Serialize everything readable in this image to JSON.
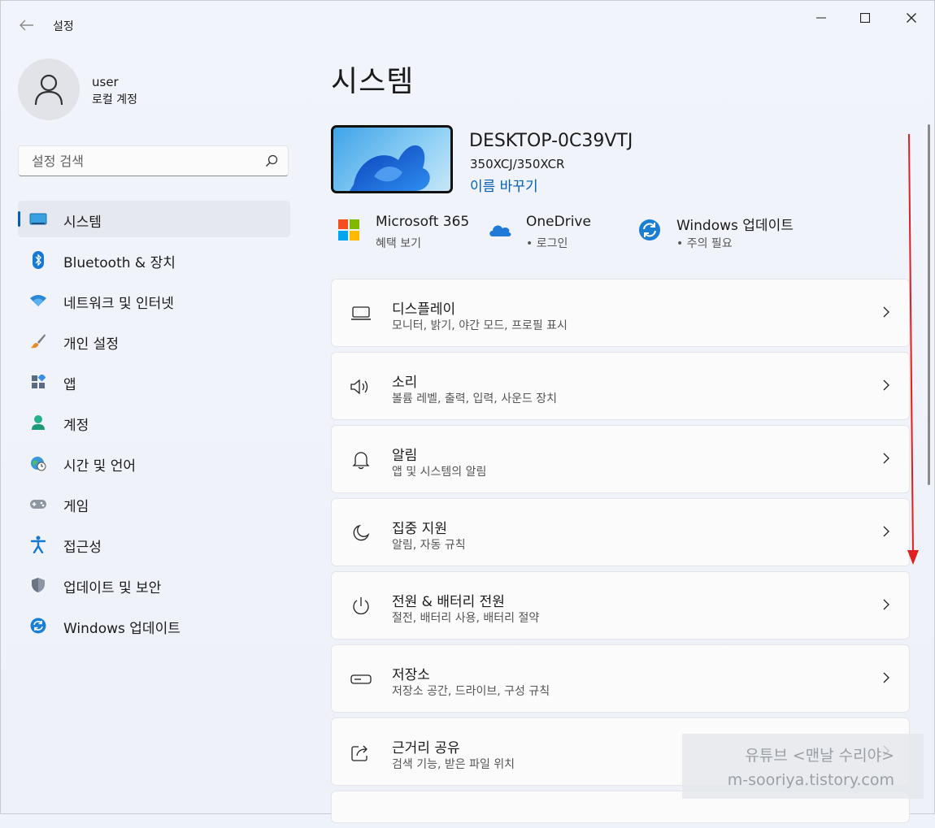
{
  "window": {
    "title": "설정",
    "back_icon": "back-arrow-icon"
  },
  "user": {
    "name": "user",
    "account_type": "로컬 계정"
  },
  "search": {
    "placeholder": "설정 검색"
  },
  "sidebar": {
    "items": [
      {
        "label": "시스템",
        "icon": "system-icon",
        "active": true
      },
      {
        "label": "Bluetooth & 장치",
        "icon": "bluetooth-icon"
      },
      {
        "label": "네트워크 및 인터넷",
        "icon": "wifi-icon"
      },
      {
        "label": "개인 설정",
        "icon": "brush-icon"
      },
      {
        "label": "앱",
        "icon": "apps-icon"
      },
      {
        "label": "계정",
        "icon": "account-icon"
      },
      {
        "label": "시간 및 언어",
        "icon": "globe-clock-icon"
      },
      {
        "label": "게임",
        "icon": "gamepad-icon"
      },
      {
        "label": "접근성",
        "icon": "accessibility-icon"
      },
      {
        "label": "업데이트 및 보안",
        "icon": "shield-icon"
      },
      {
        "label": "Windows 업데이트",
        "icon": "windows-update-icon"
      }
    ]
  },
  "main": {
    "title": "시스템",
    "device": {
      "name": "DESKTOP-0C39VTJ",
      "model": "350XCJ/350XCR",
      "rename": "이름 바꾸기"
    },
    "quick_links": [
      {
        "title": "Microsoft 365",
        "subtitle": "혜택 보기",
        "icon": "microsoft-logo-icon"
      },
      {
        "title": "OneDrive",
        "subtitle": "• 로그인",
        "icon": "onedrive-cloud-icon"
      },
      {
        "title": "Windows 업데이트",
        "subtitle": "• 주의 필요",
        "icon": "windows-update-icon"
      }
    ],
    "cards": [
      {
        "title": "디스플레이",
        "subtitle": "모니터, 밝기, 야간 모드, 프로필 표시",
        "icon": "laptop-icon"
      },
      {
        "title": "소리",
        "subtitle": "볼륨 레벨, 출력, 입력, 사운드 장치",
        "icon": "speaker-icon"
      },
      {
        "title": "알림",
        "subtitle": "앱 및 시스템의 알림",
        "icon": "bell-icon"
      },
      {
        "title": "집중 지원",
        "subtitle": "알림, 자동 규칙",
        "icon": "moon-icon"
      },
      {
        "title": "전원 & 배터리 전원",
        "subtitle": "절전, 배터리 사용, 배터리 절약",
        "icon": "power-icon"
      },
      {
        "title": "저장소",
        "subtitle": "저장소 공간, 드라이브, 구성 규칙",
        "icon": "storage-drive-icon"
      },
      {
        "title": "근거리 공유",
        "subtitle": "검색 기능, 받은 파일 위치",
        "icon": "share-icon"
      }
    ]
  },
  "watermark": {
    "line1": "유튜브 <맨날 수리야>",
    "line2": "m-sooriya.tistory.com"
  },
  "colors": {
    "accent": "#005fb8",
    "annotation_arrow": "#e02020"
  }
}
